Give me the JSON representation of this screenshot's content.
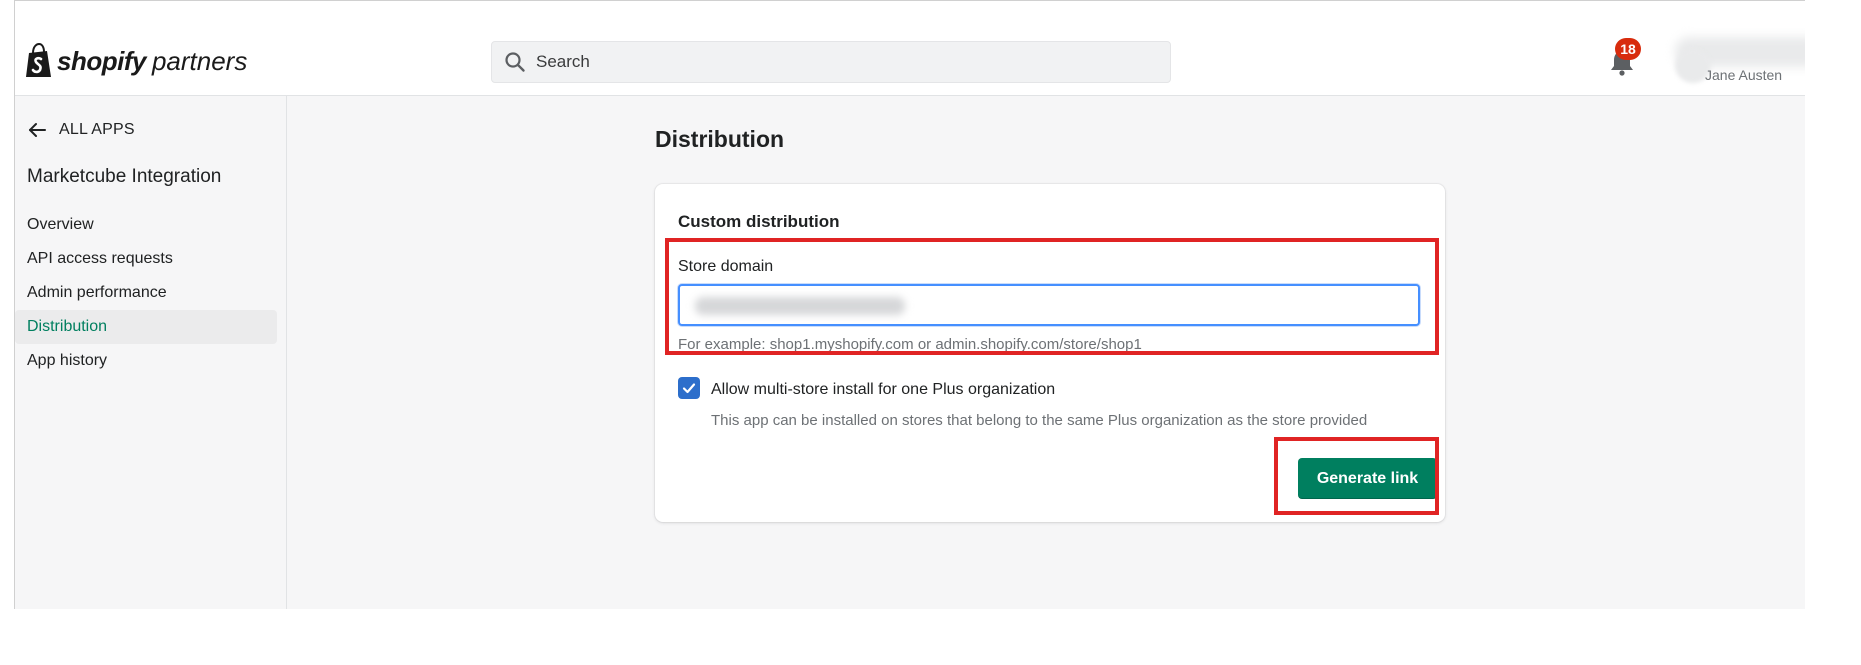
{
  "header": {
    "logo_bold": "shopify",
    "logo_light": "partners",
    "search_placeholder": "Search",
    "notification_count": "18",
    "user_name": "Jane Austen"
  },
  "sidebar": {
    "back_label": "ALL APPS",
    "app_name": "Marketcube Integration",
    "items": [
      {
        "label": "Overview",
        "active": false
      },
      {
        "label": "API access requests",
        "active": false
      },
      {
        "label": "Admin performance",
        "active": false
      },
      {
        "label": "Distribution",
        "active": true
      },
      {
        "label": "App history",
        "active": false
      }
    ]
  },
  "main": {
    "title": "Distribution",
    "card": {
      "title": "Custom distribution",
      "store_domain_label": "Store domain",
      "store_domain_value": "",
      "store_domain_help": "For example: shop1.myshopify.com or admin.shopify.com/store/shop1",
      "multistore_checked": true,
      "multistore_label": "Allow multi-store install for one Plus organization",
      "multistore_help": "This app can be installed on stores that belong to the same Plus organization as the store provided",
      "generate_button": "Generate link"
    }
  },
  "colors": {
    "primary_button": "#007f5f",
    "active_nav_text": "#007f5f",
    "checkbox": "#2c6ecb",
    "badge": "#d82c0d",
    "highlight_box": "#e02424",
    "focus_border": "#458fff"
  }
}
